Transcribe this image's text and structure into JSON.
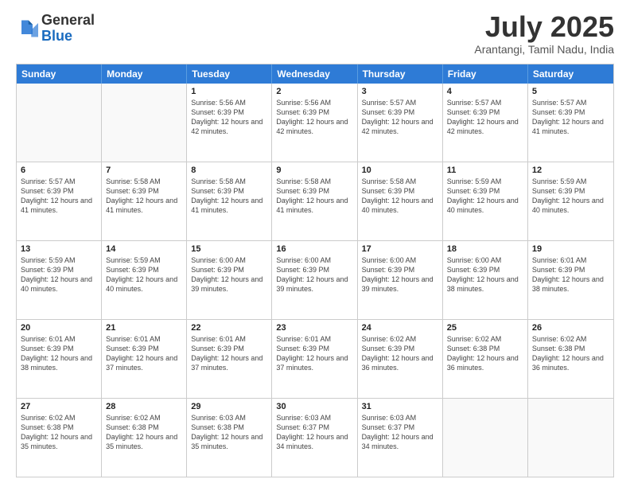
{
  "logo": {
    "general": "General",
    "blue": "Blue"
  },
  "header": {
    "month_year": "July 2025",
    "location": "Arantangi, Tamil Nadu, India"
  },
  "days_of_week": [
    "Sunday",
    "Monday",
    "Tuesday",
    "Wednesday",
    "Thursday",
    "Friday",
    "Saturday"
  ],
  "weeks": [
    [
      {
        "day": "",
        "sunrise": "",
        "sunset": "",
        "daylight": "",
        "empty": true
      },
      {
        "day": "",
        "sunrise": "",
        "sunset": "",
        "daylight": "",
        "empty": true
      },
      {
        "day": "1",
        "sunrise": "Sunrise: 5:56 AM",
        "sunset": "Sunset: 6:39 PM",
        "daylight": "Daylight: 12 hours and 42 minutes.",
        "empty": false
      },
      {
        "day": "2",
        "sunrise": "Sunrise: 5:56 AM",
        "sunset": "Sunset: 6:39 PM",
        "daylight": "Daylight: 12 hours and 42 minutes.",
        "empty": false
      },
      {
        "day": "3",
        "sunrise": "Sunrise: 5:57 AM",
        "sunset": "Sunset: 6:39 PM",
        "daylight": "Daylight: 12 hours and 42 minutes.",
        "empty": false
      },
      {
        "day": "4",
        "sunrise": "Sunrise: 5:57 AM",
        "sunset": "Sunset: 6:39 PM",
        "daylight": "Daylight: 12 hours and 42 minutes.",
        "empty": false
      },
      {
        "day": "5",
        "sunrise": "Sunrise: 5:57 AM",
        "sunset": "Sunset: 6:39 PM",
        "daylight": "Daylight: 12 hours and 41 minutes.",
        "empty": false
      }
    ],
    [
      {
        "day": "6",
        "sunrise": "Sunrise: 5:57 AM",
        "sunset": "Sunset: 6:39 PM",
        "daylight": "Daylight: 12 hours and 41 minutes.",
        "empty": false
      },
      {
        "day": "7",
        "sunrise": "Sunrise: 5:58 AM",
        "sunset": "Sunset: 6:39 PM",
        "daylight": "Daylight: 12 hours and 41 minutes.",
        "empty": false
      },
      {
        "day": "8",
        "sunrise": "Sunrise: 5:58 AM",
        "sunset": "Sunset: 6:39 PM",
        "daylight": "Daylight: 12 hours and 41 minutes.",
        "empty": false
      },
      {
        "day": "9",
        "sunrise": "Sunrise: 5:58 AM",
        "sunset": "Sunset: 6:39 PM",
        "daylight": "Daylight: 12 hours and 41 minutes.",
        "empty": false
      },
      {
        "day": "10",
        "sunrise": "Sunrise: 5:58 AM",
        "sunset": "Sunset: 6:39 PM",
        "daylight": "Daylight: 12 hours and 40 minutes.",
        "empty": false
      },
      {
        "day": "11",
        "sunrise": "Sunrise: 5:59 AM",
        "sunset": "Sunset: 6:39 PM",
        "daylight": "Daylight: 12 hours and 40 minutes.",
        "empty": false
      },
      {
        "day": "12",
        "sunrise": "Sunrise: 5:59 AM",
        "sunset": "Sunset: 6:39 PM",
        "daylight": "Daylight: 12 hours and 40 minutes.",
        "empty": false
      }
    ],
    [
      {
        "day": "13",
        "sunrise": "Sunrise: 5:59 AM",
        "sunset": "Sunset: 6:39 PM",
        "daylight": "Daylight: 12 hours and 40 minutes.",
        "empty": false
      },
      {
        "day": "14",
        "sunrise": "Sunrise: 5:59 AM",
        "sunset": "Sunset: 6:39 PM",
        "daylight": "Daylight: 12 hours and 40 minutes.",
        "empty": false
      },
      {
        "day": "15",
        "sunrise": "Sunrise: 6:00 AM",
        "sunset": "Sunset: 6:39 PM",
        "daylight": "Daylight: 12 hours and 39 minutes.",
        "empty": false
      },
      {
        "day": "16",
        "sunrise": "Sunrise: 6:00 AM",
        "sunset": "Sunset: 6:39 PM",
        "daylight": "Daylight: 12 hours and 39 minutes.",
        "empty": false
      },
      {
        "day": "17",
        "sunrise": "Sunrise: 6:00 AM",
        "sunset": "Sunset: 6:39 PM",
        "daylight": "Daylight: 12 hours and 39 minutes.",
        "empty": false
      },
      {
        "day": "18",
        "sunrise": "Sunrise: 6:00 AM",
        "sunset": "Sunset: 6:39 PM",
        "daylight": "Daylight: 12 hours and 38 minutes.",
        "empty": false
      },
      {
        "day": "19",
        "sunrise": "Sunrise: 6:01 AM",
        "sunset": "Sunset: 6:39 PM",
        "daylight": "Daylight: 12 hours and 38 minutes.",
        "empty": false
      }
    ],
    [
      {
        "day": "20",
        "sunrise": "Sunrise: 6:01 AM",
        "sunset": "Sunset: 6:39 PM",
        "daylight": "Daylight: 12 hours and 38 minutes.",
        "empty": false
      },
      {
        "day": "21",
        "sunrise": "Sunrise: 6:01 AM",
        "sunset": "Sunset: 6:39 PM",
        "daylight": "Daylight: 12 hours and 37 minutes.",
        "empty": false
      },
      {
        "day": "22",
        "sunrise": "Sunrise: 6:01 AM",
        "sunset": "Sunset: 6:39 PM",
        "daylight": "Daylight: 12 hours and 37 minutes.",
        "empty": false
      },
      {
        "day": "23",
        "sunrise": "Sunrise: 6:01 AM",
        "sunset": "Sunset: 6:39 PM",
        "daylight": "Daylight: 12 hours and 37 minutes.",
        "empty": false
      },
      {
        "day": "24",
        "sunrise": "Sunrise: 6:02 AM",
        "sunset": "Sunset: 6:39 PM",
        "daylight": "Daylight: 12 hours and 36 minutes.",
        "empty": false
      },
      {
        "day": "25",
        "sunrise": "Sunrise: 6:02 AM",
        "sunset": "Sunset: 6:38 PM",
        "daylight": "Daylight: 12 hours and 36 minutes.",
        "empty": false
      },
      {
        "day": "26",
        "sunrise": "Sunrise: 6:02 AM",
        "sunset": "Sunset: 6:38 PM",
        "daylight": "Daylight: 12 hours and 36 minutes.",
        "empty": false
      }
    ],
    [
      {
        "day": "27",
        "sunrise": "Sunrise: 6:02 AM",
        "sunset": "Sunset: 6:38 PM",
        "daylight": "Daylight: 12 hours and 35 minutes.",
        "empty": false
      },
      {
        "day": "28",
        "sunrise": "Sunrise: 6:02 AM",
        "sunset": "Sunset: 6:38 PM",
        "daylight": "Daylight: 12 hours and 35 minutes.",
        "empty": false
      },
      {
        "day": "29",
        "sunrise": "Sunrise: 6:03 AM",
        "sunset": "Sunset: 6:38 PM",
        "daylight": "Daylight: 12 hours and 35 minutes.",
        "empty": false
      },
      {
        "day": "30",
        "sunrise": "Sunrise: 6:03 AM",
        "sunset": "Sunset: 6:37 PM",
        "daylight": "Daylight: 12 hours and 34 minutes.",
        "empty": false
      },
      {
        "day": "31",
        "sunrise": "Sunrise: 6:03 AM",
        "sunset": "Sunset: 6:37 PM",
        "daylight": "Daylight: 12 hours and 34 minutes.",
        "empty": false
      },
      {
        "day": "",
        "sunrise": "",
        "sunset": "",
        "daylight": "",
        "empty": true
      },
      {
        "day": "",
        "sunrise": "",
        "sunset": "",
        "daylight": "",
        "empty": true
      }
    ]
  ]
}
